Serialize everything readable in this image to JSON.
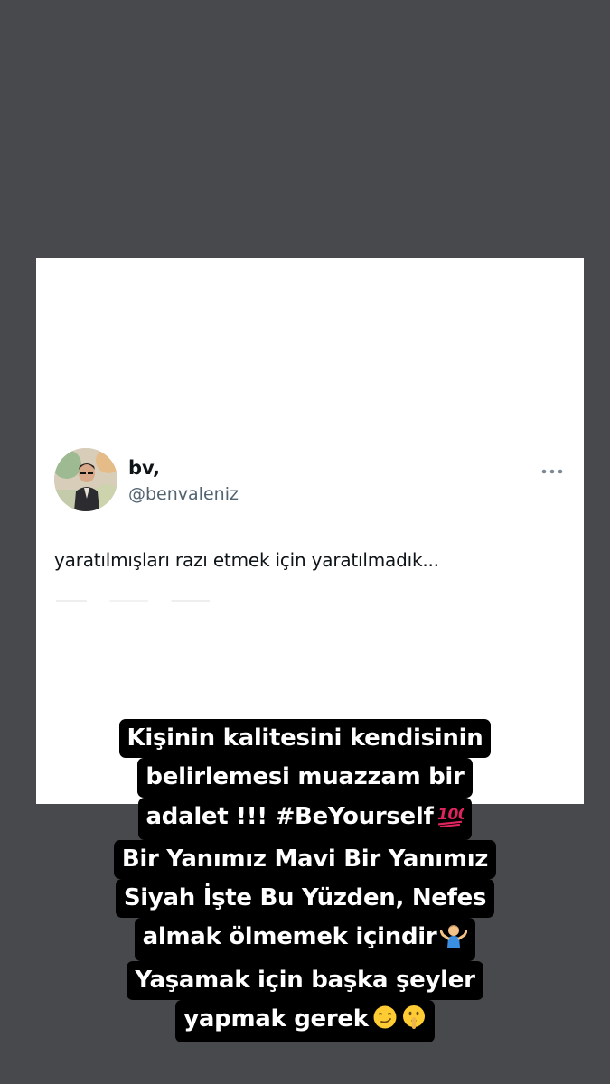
{
  "tweet": {
    "display_name": "bv,",
    "handle": "@benvaleniz",
    "text": "yaratılmışları razı etmek için yaratılmadık...",
    "more_icon": "more-horizontal-icon"
  },
  "caption": {
    "lines": [
      "Kişinin kalitesini kendisinin",
      "belirlemesi muazzam bir",
      "adalet !!! #BeYourself",
      "Bir Yanımız Mavi Bir Yanımız",
      "Siyah İşte Bu Yüzden, Nefes",
      "almak ölmemek içindir",
      "Yaşamak için başka şeyler",
      "yapmak gerek"
    ],
    "emojis": {
      "line3": "hundred-points-emoji",
      "line6": "person-shrugging-emoji",
      "line8": [
        "smirking-face-emoji",
        "shushing-face-emoji"
      ]
    }
  },
  "colors": {
    "background": "#48494c",
    "card": "#ffffff",
    "caption_bg": "#000000",
    "caption_text": "#ffffff",
    "handle": "#536471",
    "accent_red": "#e0245e"
  }
}
